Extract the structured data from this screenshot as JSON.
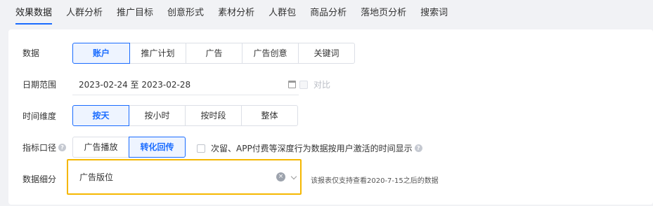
{
  "nav": {
    "tabs": [
      {
        "label": "效果数据"
      },
      {
        "label": "人群分析"
      },
      {
        "label": "推广目标"
      },
      {
        "label": "创意形式"
      },
      {
        "label": "素材分析"
      },
      {
        "label": "人群包"
      },
      {
        "label": "商品分析"
      },
      {
        "label": "落地页分析"
      },
      {
        "label": "搜索词"
      }
    ]
  },
  "filters": {
    "data_label": "数据",
    "data_options": [
      "账户",
      "推广计划",
      "广告",
      "广告创意",
      "关键词"
    ],
    "date_label": "日期范围",
    "date_value": "2023-02-24 至 2023-02-28",
    "compare_label": "对比",
    "time_label": "时间维度",
    "time_options": [
      "按天",
      "按小时",
      "按时段",
      "整体"
    ],
    "metric_label": "指标口径",
    "metric_options": [
      "广告播放",
      "转化回传"
    ],
    "metric_note": "次留、APP付费等深度行为数据按用户激活的时间显示",
    "breakdown_label": "数据细分",
    "breakdown_value": "广告版位",
    "breakdown_tip": "该报表仅支持查看2020-7-15之后的数据"
  }
}
